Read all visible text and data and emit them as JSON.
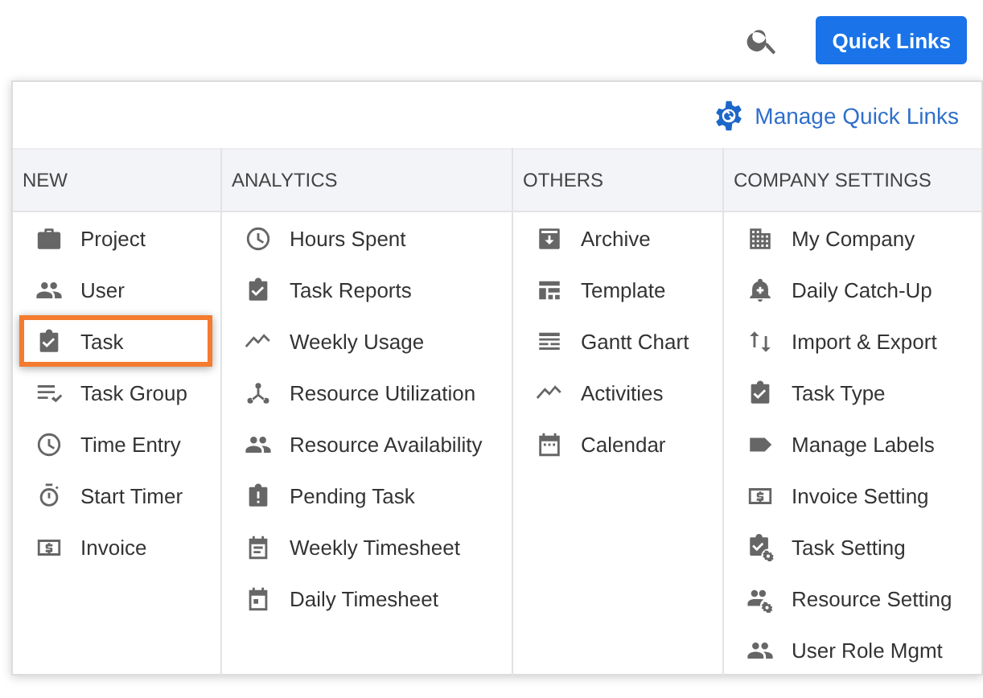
{
  "topbar": {
    "button": "Quick Links"
  },
  "panel": {
    "manage_link": "Manage Quick Links",
    "columns": [
      {
        "heading": "NEW",
        "items": [
          {
            "label": "Project",
            "selected": false
          },
          {
            "label": "User",
            "selected": false
          },
          {
            "label": "Task",
            "selected": true
          },
          {
            "label": "Task Group",
            "selected": false
          },
          {
            "label": "Time Entry",
            "selected": false
          },
          {
            "label": "Start Timer",
            "selected": false
          },
          {
            "label": "Invoice",
            "selected": false
          }
        ]
      },
      {
        "heading": "ANALYTICS",
        "items": [
          {
            "label": "Hours Spent",
            "selected": false
          },
          {
            "label": "Task Reports",
            "selected": false
          },
          {
            "label": "Weekly Usage",
            "selected": false
          },
          {
            "label": "Resource Utilization",
            "selected": false
          },
          {
            "label": "Resource Availability",
            "selected": false
          },
          {
            "label": "Pending Task",
            "selected": false
          },
          {
            "label": "Weekly Timesheet",
            "selected": false
          },
          {
            "label": "Daily Timesheet",
            "selected": false
          }
        ]
      },
      {
        "heading": "OTHERS",
        "items": [
          {
            "label": "Archive",
            "selected": false
          },
          {
            "label": "Template",
            "selected": false
          },
          {
            "label": "Gantt Chart",
            "selected": false
          },
          {
            "label": "Activities",
            "selected": false
          },
          {
            "label": "Calendar",
            "selected": false
          }
        ]
      },
      {
        "heading": "COMPANY SETTINGS",
        "items": [
          {
            "label": "My Company",
            "selected": false
          },
          {
            "label": "Daily Catch-Up",
            "selected": false
          },
          {
            "label": "Import & Export",
            "selected": false
          },
          {
            "label": "Task Type",
            "selected": false
          },
          {
            "label": "Manage Labels",
            "selected": false
          },
          {
            "label": "Invoice Setting",
            "selected": false
          },
          {
            "label": "Task Setting",
            "selected": false
          },
          {
            "label": "Resource Setting",
            "selected": false
          },
          {
            "label": "User Role Mgmt",
            "selected": false
          }
        ]
      }
    ]
  }
}
